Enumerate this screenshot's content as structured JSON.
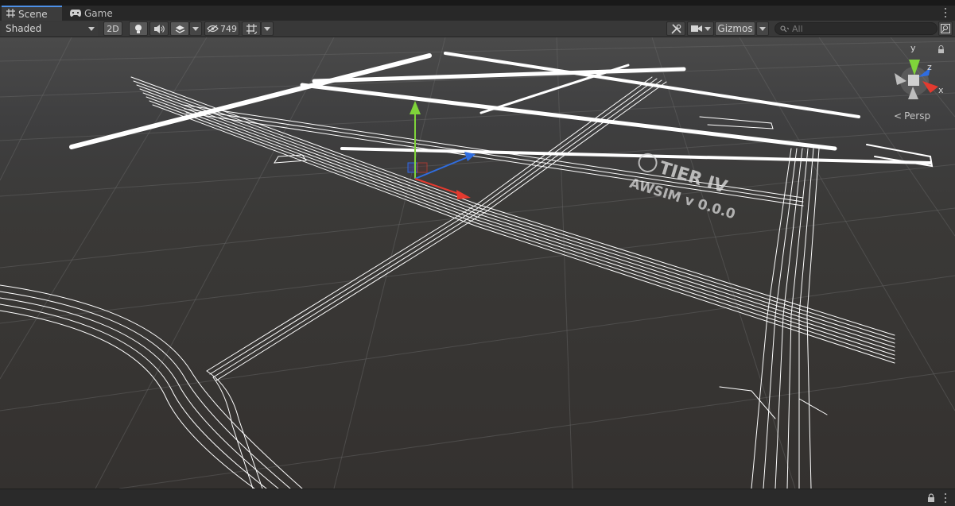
{
  "tabs": [
    {
      "label": "Scene",
      "icon": "grid-icon"
    },
    {
      "label": "Game",
      "icon": "gamepad-icon"
    }
  ],
  "toolbar": {
    "draw_mode": "Shaded",
    "mode_2d": "2D",
    "hidden_count": "749",
    "gizmos_label": "Gizmos",
    "search_placeholder": "All"
  },
  "scene": {
    "projection_label": "Persp",
    "axes": {
      "x": "x",
      "y": "y",
      "z": "z"
    },
    "watermark_brand": "TIER IV",
    "watermark_product": "AWSIM v 0.0.0"
  },
  "colors": {
    "axis_x": "#e33a2f",
    "axis_y": "#7fd43a",
    "axis_z": "#2f6de0",
    "accent_tab": "#4d90e6"
  }
}
